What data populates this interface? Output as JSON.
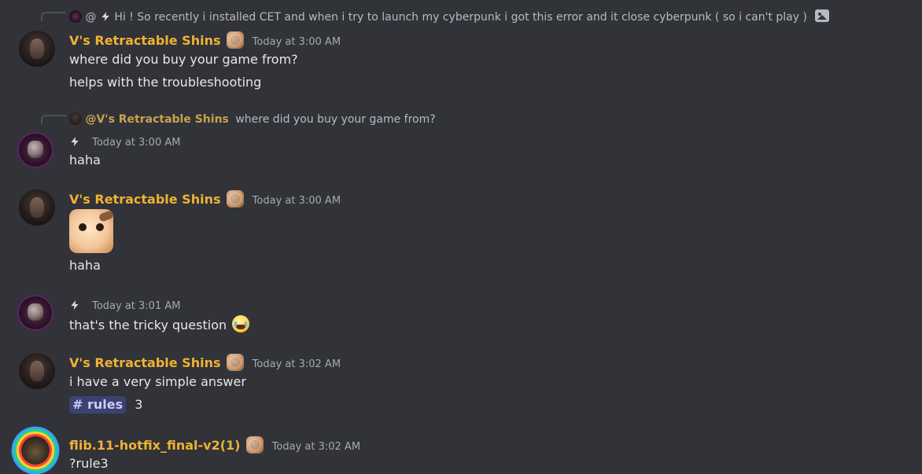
{
  "colors": {
    "background": "#313338",
    "name_yellow": "#f0b232",
    "name_mention": "#c9a24a",
    "text": "#e6e7ea",
    "muted": "#a6a9b0",
    "channel_chip_bg": "#3c4270",
    "channel_chip_text": "#c9cdfb"
  },
  "icons": {
    "badge": "squirrel-badge-icon",
    "bolt": "lightning-bolt-icon",
    "image": "image-attachment-icon",
    "emoji": "laughing-tears-emoji-icon",
    "sticker": "squirrel-sticker"
  },
  "messages": [
    {
      "reply": {
        "at": "@",
        "text": "Hi ! So recently i installed CET and when i try to launch my cyberpunk i got this error and it close cyberpunk ( so i can't play )"
      },
      "author": "V's Retractable Shins",
      "timestamp": "Today at 3:00 AM",
      "lines": [
        "where did you buy your game from?",
        "helps with the troubleshooting"
      ]
    },
    {
      "reply": {
        "mention": "@V's Retractable Shins",
        "text": "where did you buy your game from?"
      },
      "author": "",
      "timestamp": "Today at 3:00 AM",
      "lines": [
        "haha"
      ]
    },
    {
      "author": "V's Retractable Shins",
      "timestamp": "Today at 3:00 AM",
      "lines": [
        "haha"
      ]
    },
    {
      "author": "",
      "timestamp": "Today at 3:01 AM",
      "lines": [
        "that's the tricky question"
      ]
    },
    {
      "author": "V's Retractable Shins",
      "timestamp": "Today at 3:02 AM",
      "lines": [
        "i have a very simple answer"
      ],
      "channel_mention": {
        "hash": "#",
        "name": "rules",
        "suffix": "3"
      }
    },
    {
      "author": "flib.11-hotfix_final-v2(1)",
      "timestamp": "Today at 3:02 AM",
      "lines": [
        "?rule3"
      ]
    }
  ]
}
